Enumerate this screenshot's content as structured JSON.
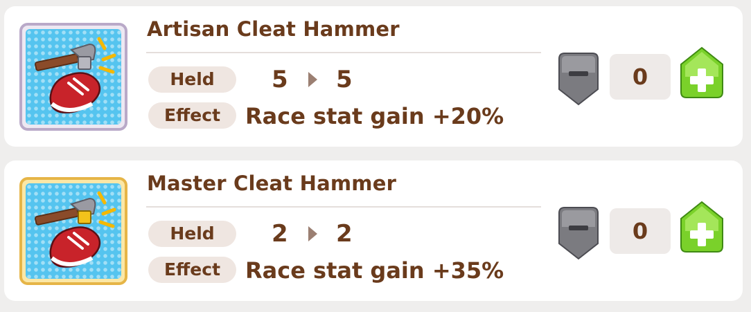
{
  "items": [
    {
      "name": "Artisan Cleat Hammer",
      "held_label": "Held",
      "held_from": "5",
      "held_to": "5",
      "effect_label": "Effect",
      "effect": "Race stat gain +20%",
      "quantity": "0",
      "frame": "silver",
      "icon": "cleat-hammer-icon"
    },
    {
      "name": "Master Cleat Hammer",
      "held_label": "Held",
      "held_from": "2",
      "held_to": "2",
      "effect_label": "Effect",
      "effect": "Race stat gain +35%",
      "quantity": "0",
      "frame": "gold",
      "icon": "cleat-hammer-icon"
    }
  ],
  "colors": {
    "text_brown": "#6a3b1c",
    "tag_bg": "#efe6e1",
    "plus_green": "#7ad12a",
    "minus_gray": "#7b7b80",
    "icon_blue": "#55c4ef"
  }
}
